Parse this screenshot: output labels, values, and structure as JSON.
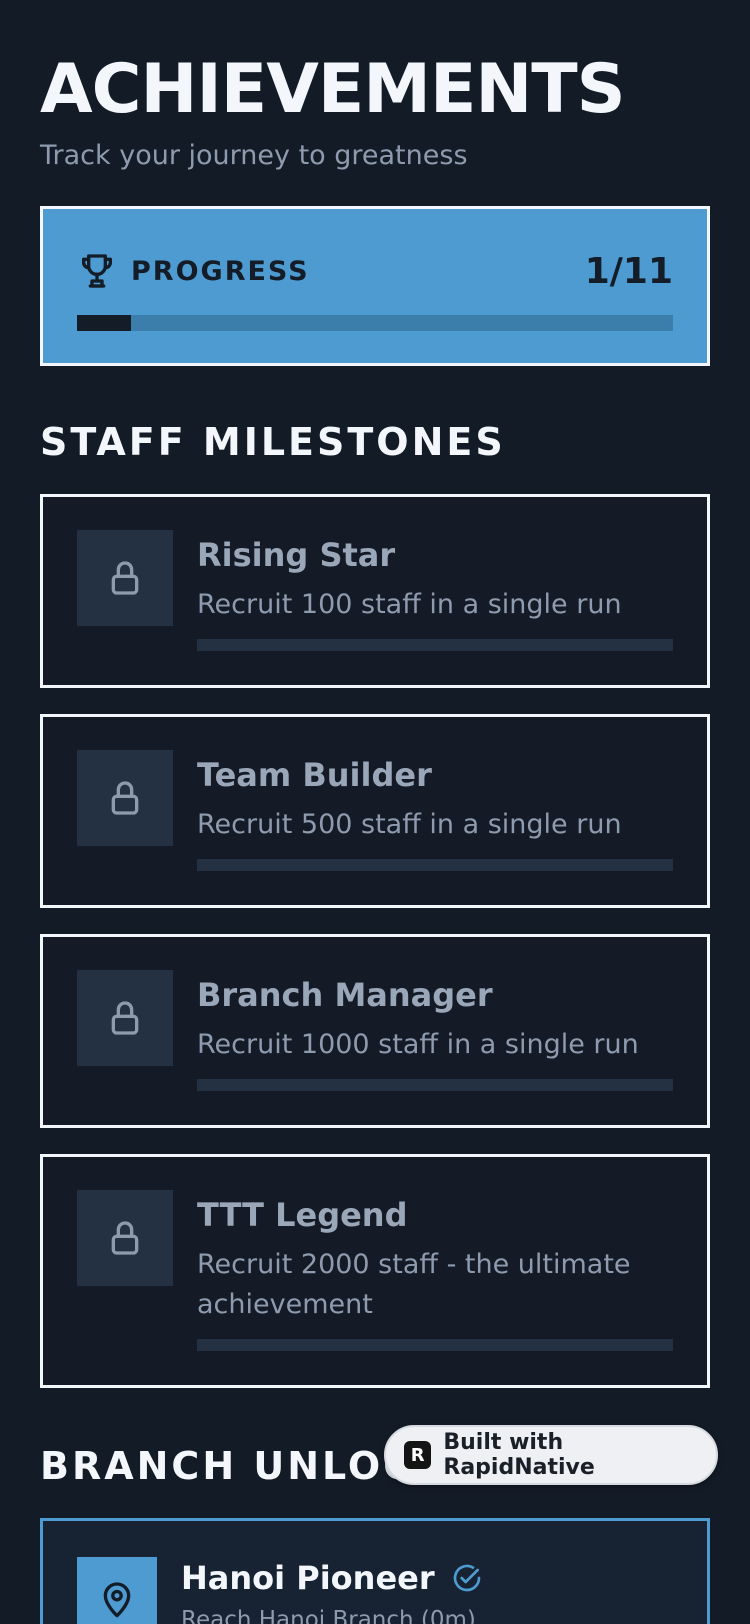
{
  "header": {
    "title": "ACHIEVEMENTS",
    "subtitle": "Track your journey to greatness"
  },
  "progress": {
    "label": "PROGRESS",
    "count": "1/11",
    "fraction": 0.0909,
    "icon": "trophy-icon"
  },
  "staff_section": {
    "title": "STAFF MILESTONES",
    "items": [
      {
        "name": "Rising Star",
        "description": "Recruit 100 staff in a single run",
        "icon": "lock-icon",
        "progress": 0
      },
      {
        "name": "Team Builder",
        "description": "Recruit 500 staff in a single run",
        "icon": "lock-icon",
        "progress": 0
      },
      {
        "name": "Branch Manager",
        "description": "Recruit 1000 staff in a single run",
        "icon": "lock-icon",
        "progress": 0
      },
      {
        "name": "TTT Legend",
        "description": "Recruit 2000 staff - the ultimate achievement",
        "icon": "lock-icon",
        "progress": 0
      }
    ]
  },
  "branch_section": {
    "title": "BRANCH UNLOCKS",
    "items": [
      {
        "name": "Hanoi Pioneer",
        "description": "Reach Hanoi Branch (0m)",
        "icon": "map-pin-icon",
        "status_icon": "check-circle-icon"
      }
    ]
  },
  "badge": {
    "logo": "R",
    "label": "Built with RapidNative"
  },
  "colors": {
    "background": "#131b26",
    "accent": "#4d9bd0",
    "card_border": "#f3f6fa",
    "locked_box": "#243142"
  }
}
